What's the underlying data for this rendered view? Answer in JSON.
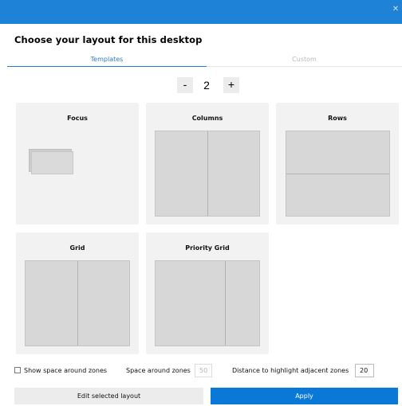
{
  "window": {
    "close_glyph": "✕",
    "accent_color": "#1e82d7"
  },
  "header": {
    "title": "Choose your layout for this desktop"
  },
  "tabs": [
    {
      "label": "Templates",
      "selected": true
    },
    {
      "label": "Custom",
      "selected": false
    }
  ],
  "zone_stepper": {
    "minus_label": "-",
    "value": "2",
    "plus_label": "+"
  },
  "templates": [
    {
      "label": "Focus"
    },
    {
      "label": "Columns"
    },
    {
      "label": "Rows"
    },
    {
      "label": "Grid"
    },
    {
      "label": "Priority Grid"
    }
  ],
  "settings": {
    "show_space_label": "Show space around zones",
    "show_space_checked": false,
    "space_around_label": "Space around zones",
    "space_around_value": "50",
    "distance_label": "Distance to highlight adjacent zones",
    "distance_value": "20"
  },
  "actions": {
    "edit_label": "Edit selected layout",
    "apply_label": "Apply",
    "apply_color": "#0a78d7"
  }
}
